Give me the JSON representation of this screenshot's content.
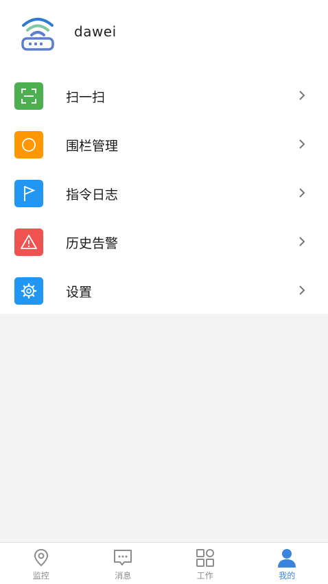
{
  "user": {
    "name": "dawei"
  },
  "menu": {
    "items": [
      {
        "label": "扫一扫",
        "icon": "scan-icon",
        "color": "#4caf50"
      },
      {
        "label": "围栏管理",
        "icon": "fence-icon",
        "color": "#ff9800"
      },
      {
        "label": "指令日志",
        "icon": "flag-icon",
        "color": "#2196f3"
      },
      {
        "label": "历史告警",
        "icon": "warning-icon",
        "color": "#ef5350"
      },
      {
        "label": "设置",
        "icon": "gear-icon",
        "color": "#2196f3"
      }
    ]
  },
  "tabbar": {
    "tabs": [
      {
        "label": "监控",
        "icon": "location-pin-icon"
      },
      {
        "label": "消息",
        "icon": "message-icon"
      },
      {
        "label": "工作",
        "icon": "grid-icon"
      },
      {
        "label": "我的",
        "icon": "person-icon",
        "active": true
      }
    ]
  },
  "colors": {
    "accent": "#3a84e0",
    "inactive": "#8c8c8c"
  }
}
